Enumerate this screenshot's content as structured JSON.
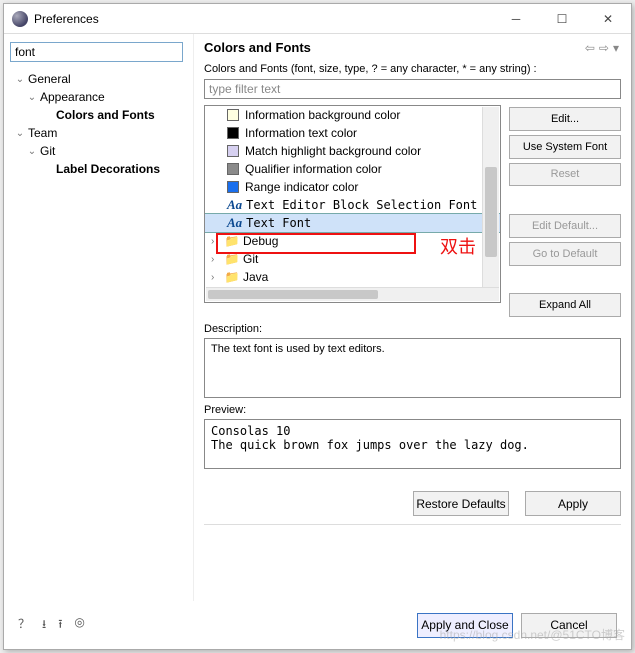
{
  "window": {
    "title": "Preferences"
  },
  "search": {
    "value": "font"
  },
  "sidebar": {
    "nodes": [
      {
        "label": "General",
        "bold": false
      },
      {
        "label": "Appearance",
        "bold": false
      },
      {
        "label": "Colors and Fonts",
        "bold": true
      },
      {
        "label": "Team",
        "bold": false
      },
      {
        "label": "Git",
        "bold": false
      },
      {
        "label": "Label Decorations",
        "bold": true
      }
    ]
  },
  "page": {
    "title": "Colors and Fonts",
    "hint": "Colors and Fonts (font, size, type, ? = any character, * = any string) :",
    "filter_placeholder": "type filter text",
    "items": [
      {
        "label": "Information background color",
        "swatch": "#ffffe1"
      },
      {
        "label": "Information text color",
        "swatch": "#000000"
      },
      {
        "label": "Match highlight background color",
        "swatch": "#d6d0f0"
      },
      {
        "label": "Qualifier information color",
        "swatch": "#8a8a8a"
      },
      {
        "label": "Range indicator color",
        "swatch": "#1a6fed"
      },
      {
        "label": "Text Editor Block Selection Font",
        "font": true
      },
      {
        "label": "Text Font",
        "font": true,
        "selected": true
      }
    ],
    "folders": [
      "Debug",
      "Git",
      "Java"
    ],
    "annotate": "双击",
    "description_label": "Description:",
    "description_text": "The text font is used by text editors.",
    "preview_label": "Preview:",
    "preview_text": "Consolas 10\nThe quick brown fox jumps over the lazy dog."
  },
  "buttons": {
    "edit": "Edit...",
    "use_system": "Use System Font",
    "reset": "Reset",
    "edit_default": "Edit Default...",
    "go_default": "Go to Default",
    "expand_all": "Expand All",
    "restore": "Restore Defaults",
    "apply": "Apply",
    "apply_close": "Apply and Close",
    "cancel": "Cancel"
  },
  "watermark": "https://blog.csdn.net/@51CTO博客"
}
